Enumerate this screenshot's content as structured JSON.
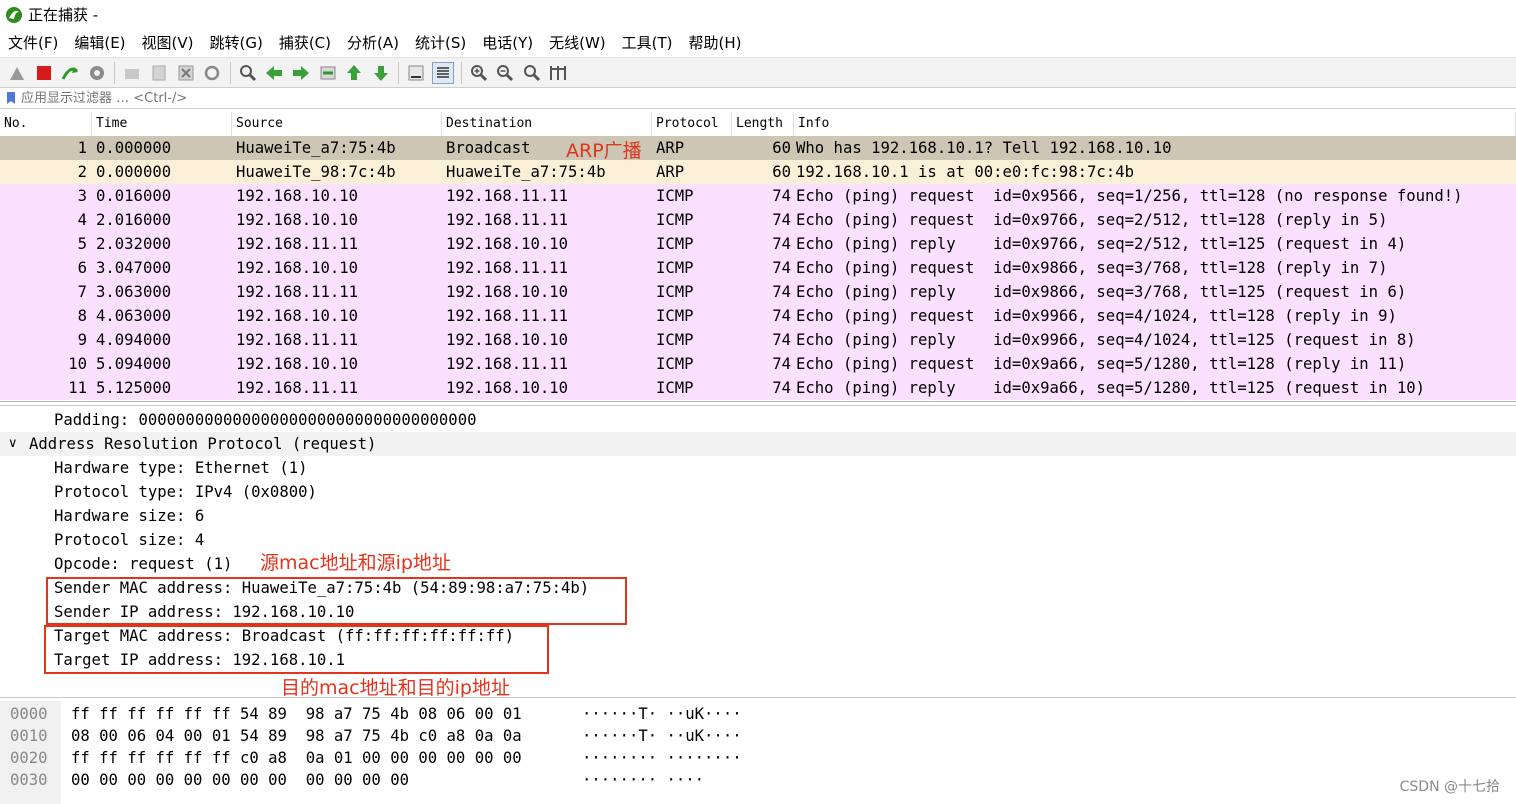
{
  "window": {
    "title": "正在捕获 -"
  },
  "menu": [
    "文件(F)",
    "编辑(E)",
    "视图(V)",
    "跳转(G)",
    "捕获(C)",
    "分析(A)",
    "统计(S)",
    "电话(Y)",
    "无线(W)",
    "工具(T)",
    "帮助(H)"
  ],
  "toolbar_icons": [
    "fin-icon",
    "stop-icon",
    "restart-icon",
    "options-icon",
    "open-icon",
    "save-icon",
    "close-icon",
    "reload-icon",
    "find-icon",
    "back-icon",
    "forward-icon",
    "goto-icon",
    "first-icon",
    "last-icon",
    "autoscroll-icon",
    "colorize-icon",
    "zoom-in-icon",
    "zoom-out-icon",
    "zoom-normal-icon",
    "resize-columns-icon"
  ],
  "filter": {
    "placeholder": "应用显示过滤器 … <Ctrl-/>"
  },
  "packet_list": {
    "columns": [
      "No.",
      "Time",
      "Source",
      "Destination",
      "Protocol",
      "Length",
      "Info"
    ],
    "rows": [
      {
        "no": "1",
        "time": "0.000000",
        "src": "HuaweiTe_a7:75:4b",
        "dst": "Broadcast",
        "proto": "ARP",
        "len": "60",
        "info": "Who has 192.168.10.1? Tell 192.168.10.10",
        "bg": "#cdc6b4"
      },
      {
        "no": "2",
        "time": "0.000000",
        "src": "HuaweiTe_98:7c:4b",
        "dst": "HuaweiTe_a7:75:4b",
        "proto": "ARP",
        "len": "60",
        "info": "192.168.10.1 is at 00:e0:fc:98:7c:4b",
        "bg": "#faf0d7"
      },
      {
        "no": "3",
        "time": "0.016000",
        "src": "192.168.10.10",
        "dst": "192.168.11.11",
        "proto": "ICMP",
        "len": "74",
        "info": "Echo (ping) request  id=0x9566, seq=1/256, ttl=128 (no response found!)",
        "bg": "#fce0ff"
      },
      {
        "no": "4",
        "time": "2.016000",
        "src": "192.168.10.10",
        "dst": "192.168.11.11",
        "proto": "ICMP",
        "len": "74",
        "info": "Echo (ping) request  id=0x9766, seq=2/512, ttl=128 (reply in 5)",
        "bg": "#fce0ff"
      },
      {
        "no": "5",
        "time": "2.032000",
        "src": "192.168.11.11",
        "dst": "192.168.10.10",
        "proto": "ICMP",
        "len": "74",
        "info": "Echo (ping) reply    id=0x9766, seq=2/512, ttl=125 (request in 4)",
        "bg": "#fce0ff"
      },
      {
        "no": "6",
        "time": "3.047000",
        "src": "192.168.10.10",
        "dst": "192.168.11.11",
        "proto": "ICMP",
        "len": "74",
        "info": "Echo (ping) request  id=0x9866, seq=3/768, ttl=128 (reply in 7)",
        "bg": "#fce0ff"
      },
      {
        "no": "7",
        "time": "3.063000",
        "src": "192.168.11.11",
        "dst": "192.168.10.10",
        "proto": "ICMP",
        "len": "74",
        "info": "Echo (ping) reply    id=0x9866, seq=3/768, ttl=125 (request in 6)",
        "bg": "#fce0ff"
      },
      {
        "no": "8",
        "time": "4.063000",
        "src": "192.168.10.10",
        "dst": "192.168.11.11",
        "proto": "ICMP",
        "len": "74",
        "info": "Echo (ping) request  id=0x9966, seq=4/1024, ttl=128 (reply in 9)",
        "bg": "#fce0ff"
      },
      {
        "no": "9",
        "time": "4.094000",
        "src": "192.168.11.11",
        "dst": "192.168.10.10",
        "proto": "ICMP",
        "len": "74",
        "info": "Echo (ping) reply    id=0x9966, seq=4/1024, ttl=125 (request in 8)",
        "bg": "#fce0ff"
      },
      {
        "no": "10",
        "time": "5.094000",
        "src": "192.168.10.10",
        "dst": "192.168.11.11",
        "proto": "ICMP",
        "len": "74",
        "info": "Echo (ping) request  id=0x9a66, seq=5/1280, ttl=128 (reply in 11)",
        "bg": "#fce0ff"
      },
      {
        "no": "11",
        "time": "5.125000",
        "src": "192.168.11.11",
        "dst": "192.168.10.10",
        "proto": "ICMP",
        "len": "74",
        "info": "Echo (ping) reply    id=0x9a66, seq=5/1280, ttl=125 (request in 10)",
        "bg": "#fce0ff"
      }
    ]
  },
  "details": [
    {
      "text": "Padding: 000000000000000000000000000000000000",
      "indent": 1
    },
    {
      "text": "Address Resolution Protocol (request)",
      "indent": 0,
      "expanded": true,
      "caret": "∨"
    },
    {
      "text": "Hardware type: Ethernet (1)",
      "indent": 1
    },
    {
      "text": "Protocol type: IPv4 (0x0800)",
      "indent": 1
    },
    {
      "text": "Hardware size: 6",
      "indent": 1
    },
    {
      "text": "Protocol size: 4",
      "indent": 1
    },
    {
      "text": "Opcode: request (1)",
      "indent": 1
    },
    {
      "text": "Sender MAC address: HuaweiTe_a7:75:4b (54:89:98:a7:75:4b)",
      "indent": 1
    },
    {
      "text": "Sender IP address: 192.168.10.10",
      "indent": 1
    },
    {
      "text": "Target MAC address: Broadcast (ff:ff:ff:ff:ff:ff)",
      "indent": 1
    },
    {
      "text": "Target IP address: 192.168.10.1",
      "indent": 1
    }
  ],
  "annotations": {
    "arp_broadcast": "ARP广播",
    "src_label": "源mac地址和源ip地址",
    "dst_label": "目的mac地址和目的ip地址"
  },
  "hex": [
    {
      "offset": "0000",
      "bytes": "ff ff ff ff ff ff 54 89  98 a7 75 4b 08 06 00 01",
      "ascii": "······T· ··uK····"
    },
    {
      "offset": "0010",
      "bytes": "08 00 06 04 00 01 54 89  98 a7 75 4b c0 a8 0a 0a",
      "ascii": "······T· ··uK····"
    },
    {
      "offset": "0020",
      "bytes": "ff ff ff ff ff ff c0 a8  0a 01 00 00 00 00 00 00",
      "ascii": "········ ········"
    },
    {
      "offset": "0030",
      "bytes": "00 00 00 00 00 00 00 00  00 00 00 00",
      "ascii": "········ ····"
    }
  ],
  "watermark": "CSDN @十七拾",
  "colors": {
    "accent": "#e2331c",
    "arp_row": "#cdc6b4",
    "arp_reply_row": "#faf0d7",
    "icmp_row": "#fce0ff"
  }
}
